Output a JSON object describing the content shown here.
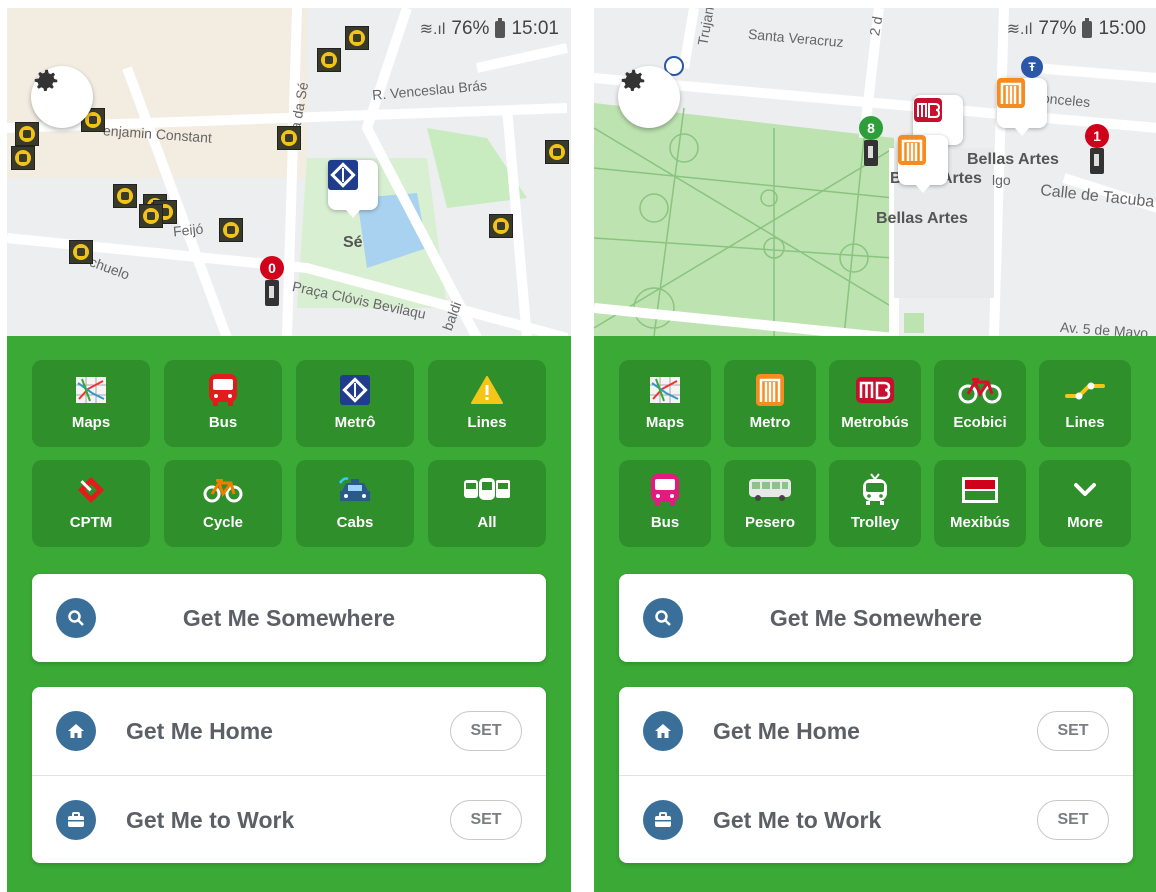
{
  "screens": [
    {
      "status": {
        "battery": "76%",
        "time": "15:01"
      },
      "map": {
        "streets": [
          "R. Venceslau Brás",
          "enjamin Constant",
          "Feijó",
          "chuelo",
          "Praça Clóvis Bevilaqu",
          "baldi",
          "a da Sé"
        ],
        "station_label": "Sé",
        "badge_count": "0"
      },
      "tiles": [
        {
          "label": "Maps",
          "icon": "maps-icon"
        },
        {
          "label": "Bus",
          "icon": "bus-icon"
        },
        {
          "label": "Metrô",
          "icon": "metro-icon"
        },
        {
          "label": "Lines",
          "icon": "warning-icon"
        },
        {
          "label": "CPTM",
          "icon": "cptm-icon"
        },
        {
          "label": "Cycle",
          "icon": "bicycle-icon"
        },
        {
          "label": "Cabs",
          "icon": "taxi-icon"
        },
        {
          "label": "All",
          "icon": "all-transit-icon"
        }
      ],
      "search_label": "Get Me Somewhere",
      "home_label": "Get Me Home",
      "work_label": "Get Me to Work",
      "set_label": "SET"
    },
    {
      "status": {
        "battery": "77%",
        "time": "15:00"
      },
      "map": {
        "streets": [
          "Santa Veracruz",
          "Trujan",
          "onceles",
          "Calle de Tacuba",
          "Av. 5 de Mayo",
          "lgo",
          "2 d"
        ],
        "poi_1": "Bellas Artes",
        "poi_2": "Bellas Artes",
        "poi_3": "Bellas Artes",
        "badge_green": "8",
        "badge_red": "1"
      },
      "tiles": [
        {
          "label": "Maps",
          "icon": "maps-icon"
        },
        {
          "label": "Metro",
          "icon": "metro-icon"
        },
        {
          "label": "Metrobús",
          "icon": "metrobus-icon"
        },
        {
          "label": "Ecobici",
          "icon": "bicycle-icon"
        },
        {
          "label": "Lines",
          "icon": "lines-icon"
        },
        {
          "label": "Bus",
          "icon": "bus-icon"
        },
        {
          "label": "Pesero",
          "icon": "pesero-icon"
        },
        {
          "label": "Trolley",
          "icon": "trolley-icon"
        },
        {
          "label": "Mexibús",
          "icon": "mexibus-icon"
        },
        {
          "label": "More",
          "icon": "chevron-down-icon"
        }
      ],
      "search_label": "Get Me Somewhere",
      "home_label": "Get Me Home",
      "work_label": "Get Me to Work",
      "set_label": "SET"
    }
  ],
  "colors": {
    "brand_green": "#3aa935",
    "tile_green": "#2e8f2b",
    "icon_blue": "#396f99",
    "badge_red": "#d0021b"
  }
}
